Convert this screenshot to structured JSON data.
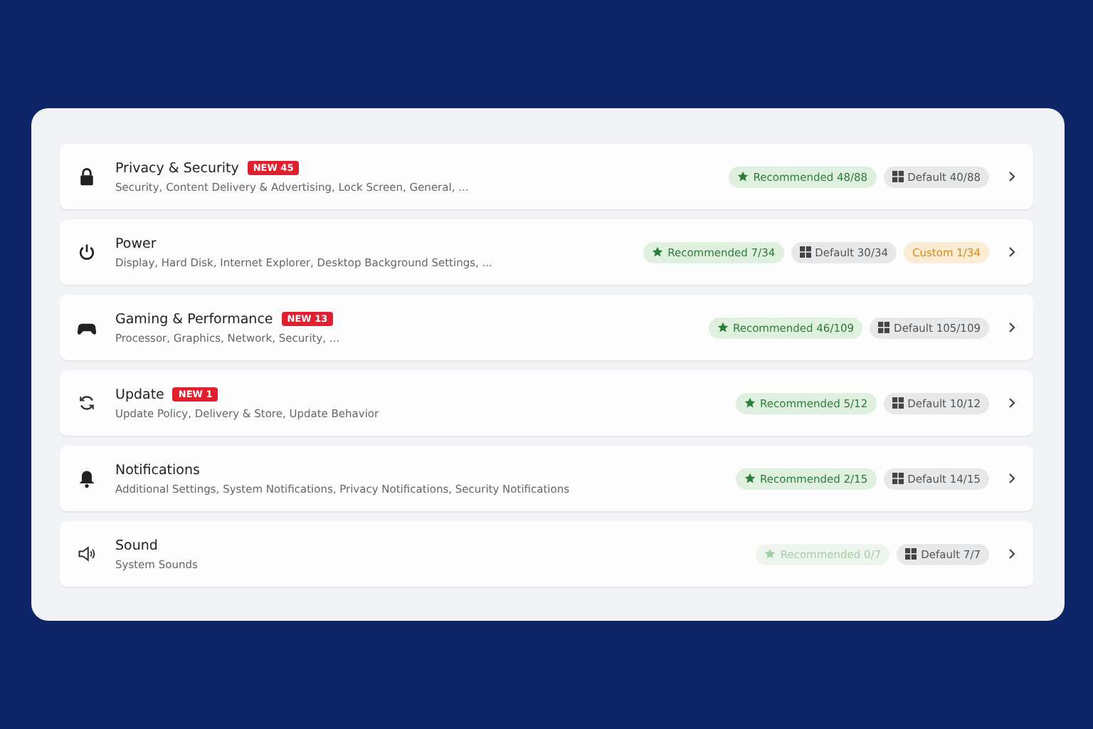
{
  "categories": [
    {
      "title": "Privacy & Security",
      "badge": "NEW 45",
      "subtitle": "Security, Content Delivery & Advertising, Lock Screen, General, ...",
      "chips": [
        {
          "kind": "recommended",
          "label": "Recommended 48/88",
          "disabled": false
        },
        {
          "kind": "default",
          "label": "Default 40/88",
          "disabled": false
        }
      ]
    },
    {
      "title": "Power",
      "subtitle": "Display, Hard Disk, Internet Explorer, Desktop Background Settings, ...",
      "chips": [
        {
          "kind": "recommended",
          "label": "Recommended 7/34",
          "disabled": false
        },
        {
          "kind": "default",
          "label": "Default 30/34",
          "disabled": false
        },
        {
          "kind": "custom",
          "label": "Custom 1/34",
          "disabled": false
        }
      ]
    },
    {
      "title": "Gaming & Performance",
      "badge": "NEW 13",
      "subtitle": "Processor, Graphics, Network, Security, ...",
      "chips": [
        {
          "kind": "recommended",
          "label": "Recommended 46/109",
          "disabled": false
        },
        {
          "kind": "default",
          "label": "Default 105/109",
          "disabled": false
        }
      ]
    },
    {
      "title": "Update",
      "badge": "NEW 1",
      "subtitle": "Update Policy, Delivery & Store, Update Behavior",
      "chips": [
        {
          "kind": "recommended",
          "label": "Recommended 5/12",
          "disabled": false
        },
        {
          "kind": "default",
          "label": "Default 10/12",
          "disabled": false
        }
      ]
    },
    {
      "title": "Notifications",
      "subtitle": "Additional Settings, System Notifications, Privacy Notifications, Security Notifications",
      "chips": [
        {
          "kind": "recommended",
          "label": "Recommended 2/15",
          "disabled": false
        },
        {
          "kind": "default",
          "label": "Default 14/15",
          "disabled": false
        }
      ]
    },
    {
      "title": "Sound",
      "subtitle": "System Sounds",
      "chips": [
        {
          "kind": "recommended",
          "label": "Recommended 0/7",
          "disabled": true
        },
        {
          "kind": "default",
          "label": "Default 7/7",
          "disabled": false
        }
      ]
    }
  ]
}
